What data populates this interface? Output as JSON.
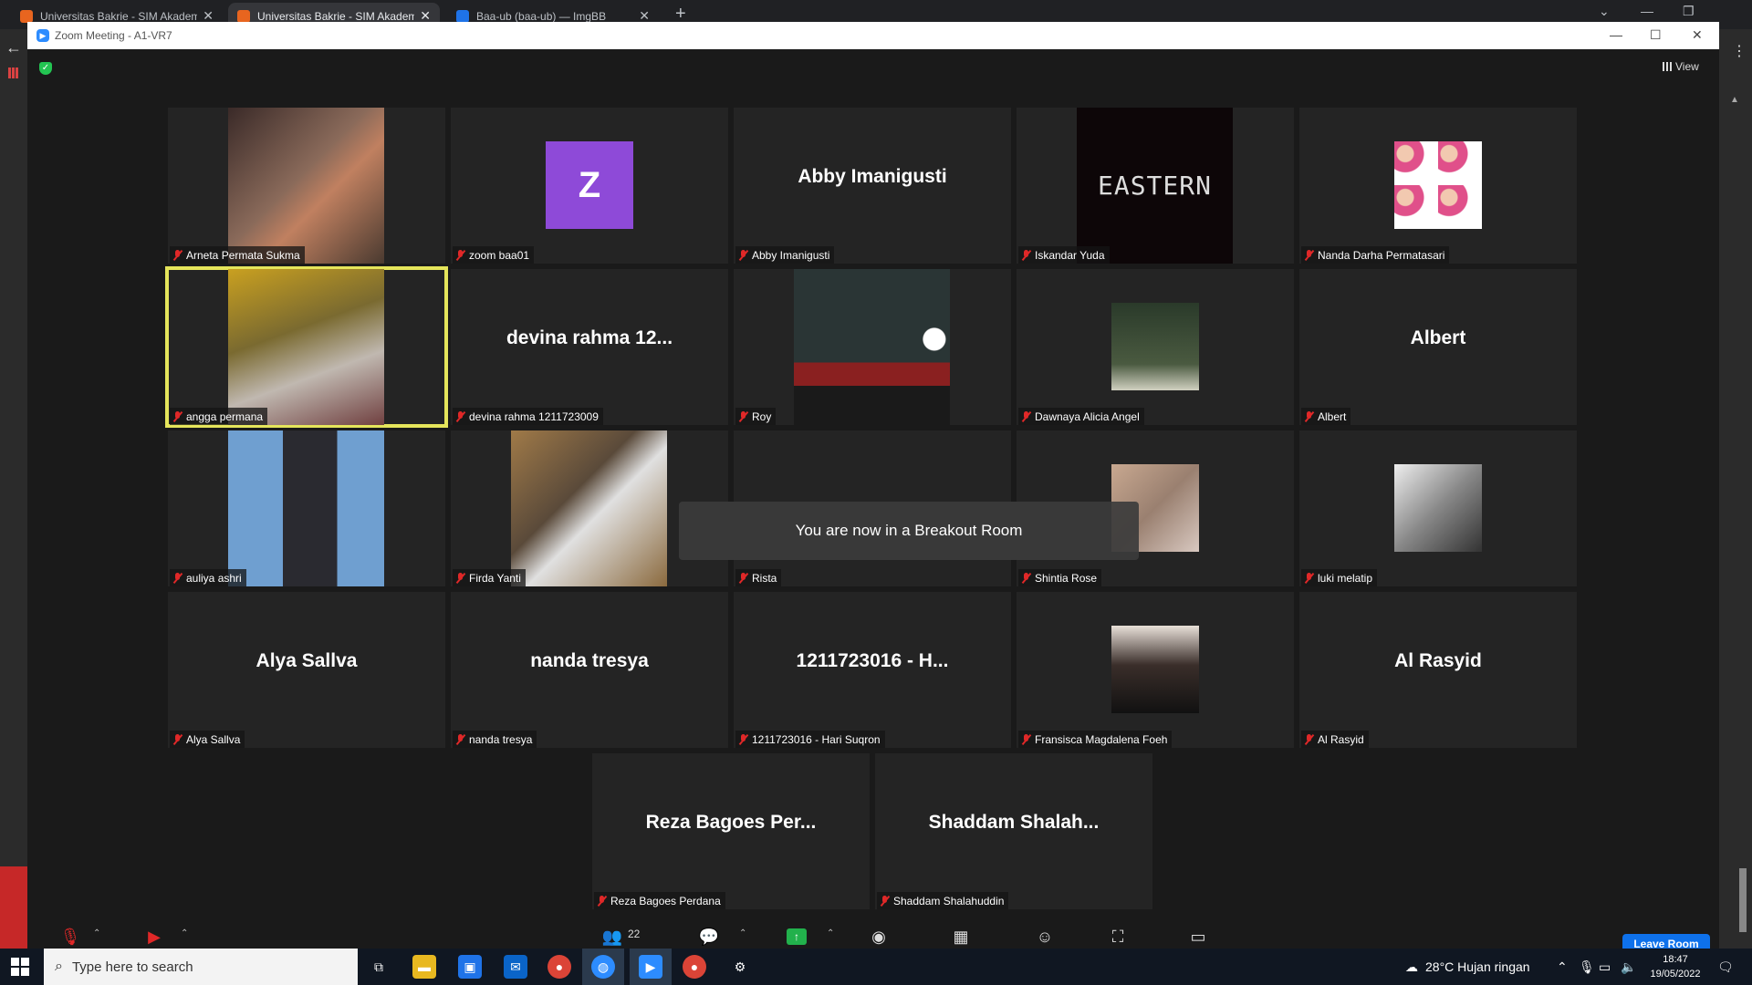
{
  "browser": {
    "tabs": [
      {
        "label": "Universitas Bakrie - SIM Akadem",
        "fav": "#e8651f",
        "active": false
      },
      {
        "label": "Universitas Bakrie - SIM Akadem",
        "fav": "#e8651f",
        "active": true
      },
      {
        "label": "Baa-ub (baa-ub) — ImgBB",
        "fav": "#1f73e8",
        "active": false
      }
    ],
    "new_tab": "+"
  },
  "zoom": {
    "title": "Zoom Meeting - A1-VR7",
    "view_label": "View",
    "toast": "You are now in a Breakout Room",
    "participant_count": "22",
    "leave_label": "Leave Room"
  },
  "tiles": [
    {
      "name": "Arneta Permata Sukma",
      "display": "",
      "photo": "#7a5a4a"
    },
    {
      "name": "zoom baa01",
      "display": "",
      "avatar": "Z"
    },
    {
      "name": "Abby Imanigusti",
      "display": "Abby Imanigusti"
    },
    {
      "name": "Iskandar Yuda",
      "display": "",
      "photo": "#0d0608",
      "photo_text": "EASTERN"
    },
    {
      "name": "Nanda Darha Permatasari",
      "display": "",
      "photo_small": "#e07fa8"
    },
    {
      "name": "angga permana",
      "display": "",
      "photo": "#8a7a3a",
      "speaker": true
    },
    {
      "name": "devina rahma 1211723009",
      "display": "devina rahma 12..."
    },
    {
      "name": "Roy",
      "display": "",
      "photo": "#2a3a3a"
    },
    {
      "name": "Dawnaya Alicia Angel",
      "display": "",
      "photo_small": "#3a4a3a"
    },
    {
      "name": "Albert",
      "display": "Albert"
    },
    {
      "name": "auliya ashri",
      "display": "",
      "photo": "#6f9fd0"
    },
    {
      "name": "Firda Yanti",
      "display": "",
      "photo": "#8b6a3e"
    },
    {
      "name": "Rista",
      "display": ""
    },
    {
      "name": "Shintia Rose",
      "display": "",
      "photo_small": "#b89a88"
    },
    {
      "name": "luki melatip",
      "display": "",
      "photo_small": "#888888"
    },
    {
      "name": "Alya Sallva",
      "display": "Alya Sallva"
    },
    {
      "name": "nanda tresya",
      "display": "nanda tresya"
    },
    {
      "name": "1211723016 - Hari Suqron",
      "display": "1211723016 - H..."
    },
    {
      "name": "Fransisca Magdalena Foeh",
      "display": "",
      "photo_small": "#3a2e2a"
    },
    {
      "name": "Al Rasyid",
      "display": "Al Rasyid"
    },
    {
      "name": "Reza Bagoes Perdana",
      "display": "Reza Bagoes Per..."
    },
    {
      "name": "Shaddam Shalahuddin",
      "display": "Shaddam Shalah..."
    }
  ],
  "taskbar": {
    "search_placeholder": "Type here to search",
    "weather": "28°C  Hujan ringan",
    "time": "18:47",
    "date": "19/05/2022"
  }
}
